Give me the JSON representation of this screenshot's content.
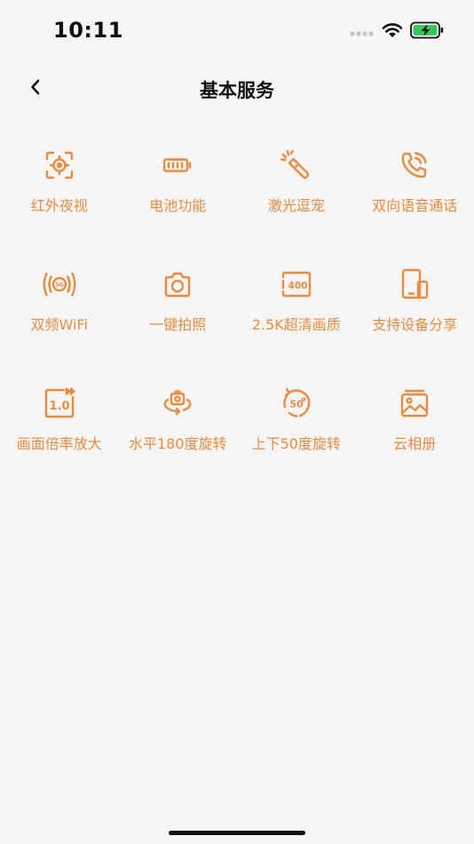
{
  "status_bar": {
    "time": "10:11"
  },
  "header": {
    "title": "基本服务"
  },
  "accent_color": "#ef8a3c",
  "services": [
    {
      "label": "红外夜视",
      "icon": "night-vision-icon"
    },
    {
      "label": "电池功能",
      "icon": "battery-icon"
    },
    {
      "label": "激光逗宠",
      "icon": "laser-pointer-icon"
    },
    {
      "label": "双向语音通话",
      "icon": "voice-call-icon"
    },
    {
      "label": "双频WiFi",
      "icon": "wifi-5g-icon"
    },
    {
      "label": "一键拍照",
      "icon": "camera-icon"
    },
    {
      "label": "2.5K超清画质",
      "icon": "resolution-400-icon"
    },
    {
      "label": "支持设备分享",
      "icon": "device-share-icon"
    },
    {
      "label": "画面倍率放大",
      "icon": "zoom-1x-icon"
    },
    {
      "label": "水平180度旋转",
      "icon": "horizontal-rotate-icon"
    },
    {
      "label": "上下50度旋转",
      "icon": "vertical-rotate-50-icon"
    },
    {
      "label": "云相册",
      "icon": "cloud-album-icon"
    }
  ]
}
